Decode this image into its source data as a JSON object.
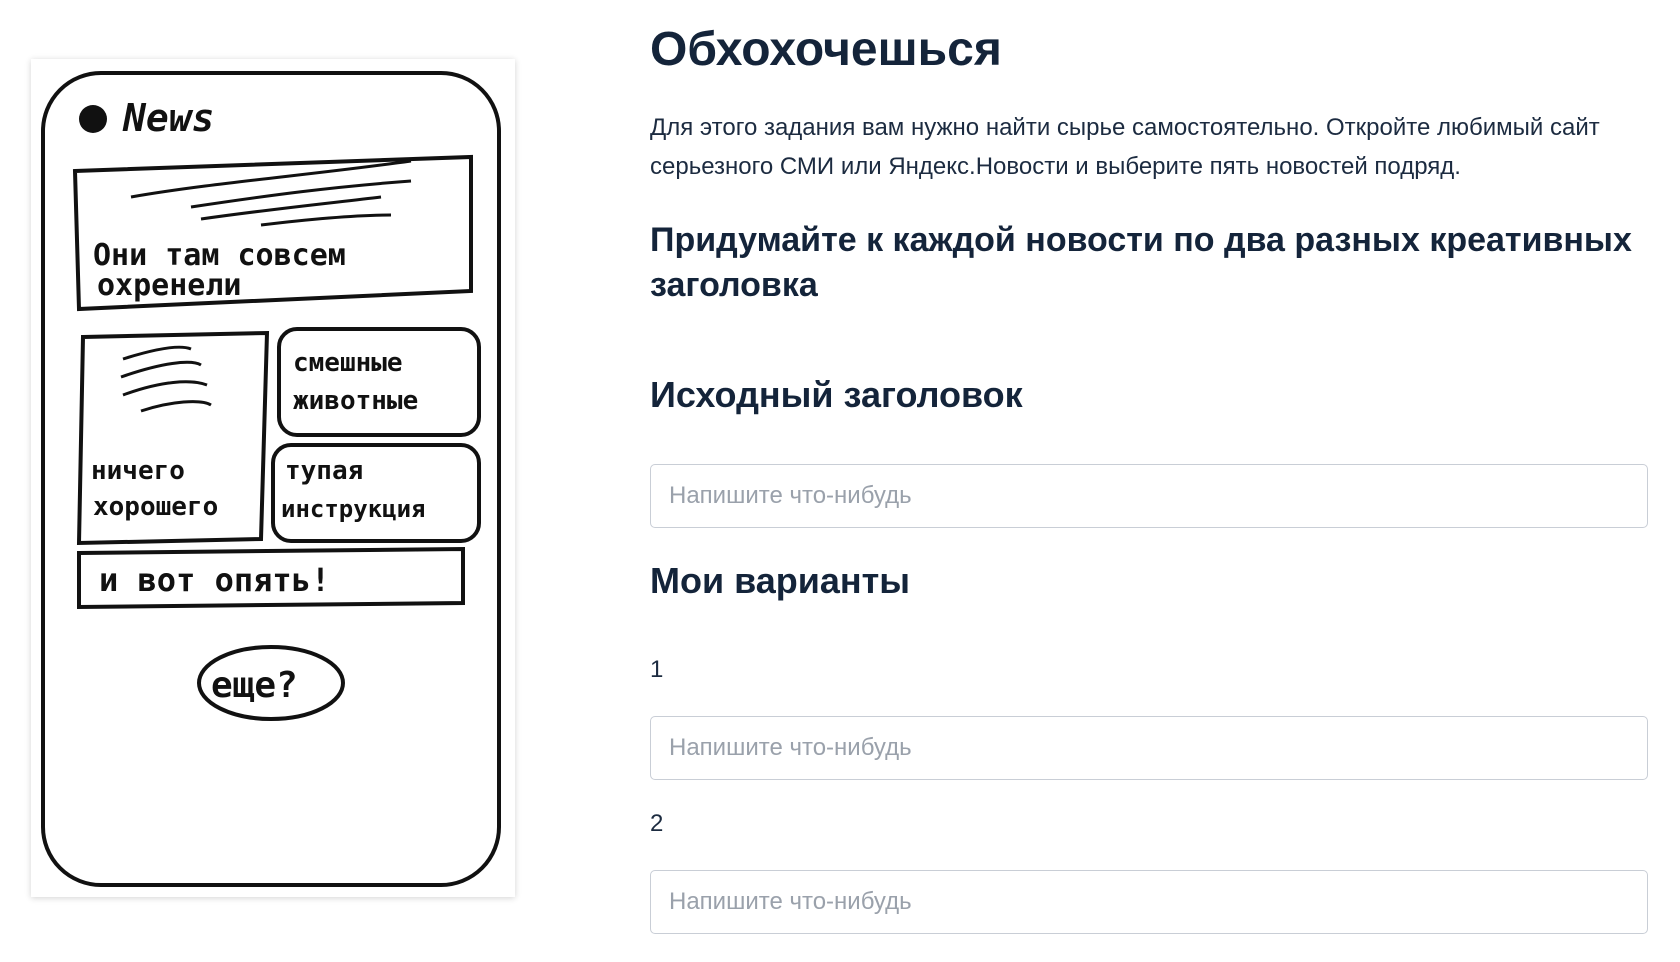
{
  "sketch": {
    "app_label": "News",
    "headline_card": [
      "Они там совсем",
      "охренели"
    ],
    "card_left": [
      "ничего",
      "хорошего"
    ],
    "card_right_top": [
      "смешные",
      "животные"
    ],
    "card_right_bottom": [
      "тупая",
      "инструкция"
    ],
    "wide_card": "и вот опять!",
    "more_button": "еще?"
  },
  "main": {
    "title": "Обхохочешься",
    "intro": "Для этого задания вам нужно найти сырье самостоятельно. Откройте любимый сайт серьезного СМИ или Яндекс.Новости и выберите пять новостей подряд.",
    "task": "Придумайте к каждой новости по два разных креативных заголовка",
    "original_heading": "Исходный заголовок",
    "original_placeholder": "Напишите что-нибудь",
    "variants_heading": "Мои варианты",
    "variants": [
      {
        "number": "1",
        "placeholder": "Напишите что-нибудь"
      },
      {
        "number": "2",
        "placeholder": "Напишите что-нибудь"
      }
    ]
  }
}
